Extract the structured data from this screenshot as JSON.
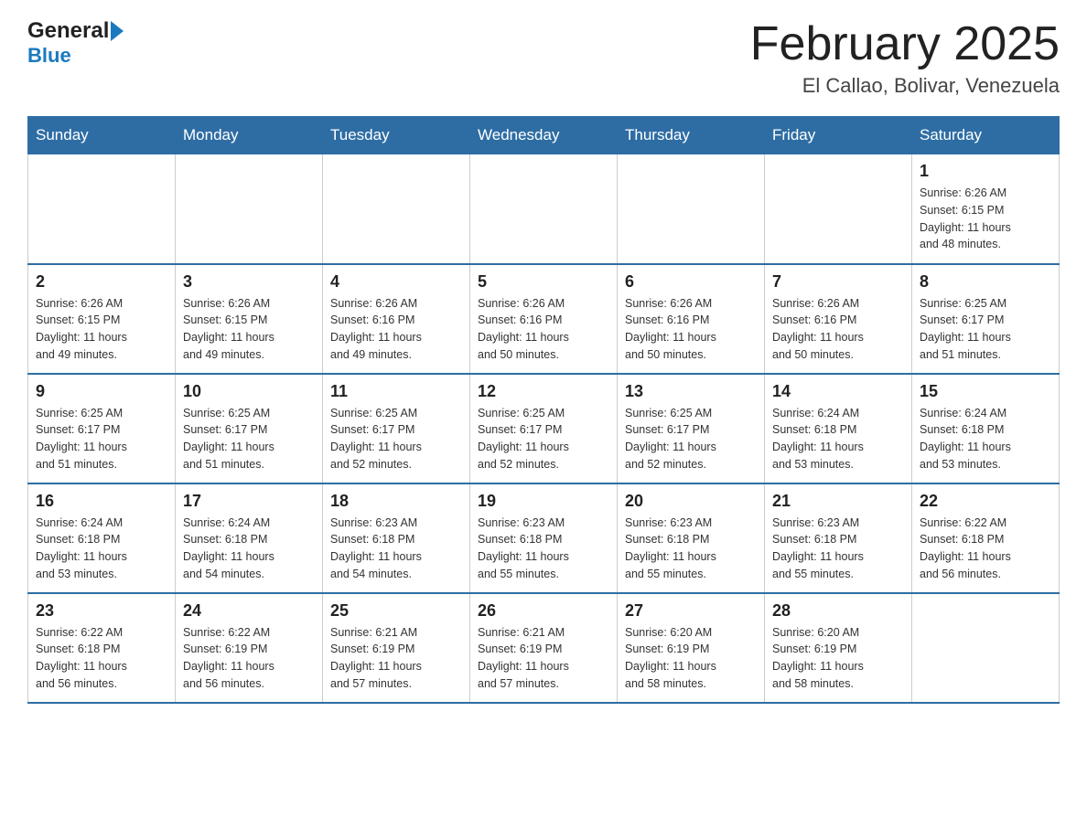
{
  "header": {
    "logo_general": "General",
    "logo_blue": "Blue",
    "title": "February 2025",
    "subtitle": "El Callao, Bolivar, Venezuela"
  },
  "weekdays": [
    "Sunday",
    "Monday",
    "Tuesday",
    "Wednesday",
    "Thursday",
    "Friday",
    "Saturday"
  ],
  "weeks": [
    [
      {
        "day": "",
        "info": ""
      },
      {
        "day": "",
        "info": ""
      },
      {
        "day": "",
        "info": ""
      },
      {
        "day": "",
        "info": ""
      },
      {
        "day": "",
        "info": ""
      },
      {
        "day": "",
        "info": ""
      },
      {
        "day": "1",
        "info": "Sunrise: 6:26 AM\nSunset: 6:15 PM\nDaylight: 11 hours\nand 48 minutes."
      }
    ],
    [
      {
        "day": "2",
        "info": "Sunrise: 6:26 AM\nSunset: 6:15 PM\nDaylight: 11 hours\nand 49 minutes."
      },
      {
        "day": "3",
        "info": "Sunrise: 6:26 AM\nSunset: 6:15 PM\nDaylight: 11 hours\nand 49 minutes."
      },
      {
        "day": "4",
        "info": "Sunrise: 6:26 AM\nSunset: 6:16 PM\nDaylight: 11 hours\nand 49 minutes."
      },
      {
        "day": "5",
        "info": "Sunrise: 6:26 AM\nSunset: 6:16 PM\nDaylight: 11 hours\nand 50 minutes."
      },
      {
        "day": "6",
        "info": "Sunrise: 6:26 AM\nSunset: 6:16 PM\nDaylight: 11 hours\nand 50 minutes."
      },
      {
        "day": "7",
        "info": "Sunrise: 6:26 AM\nSunset: 6:16 PM\nDaylight: 11 hours\nand 50 minutes."
      },
      {
        "day": "8",
        "info": "Sunrise: 6:25 AM\nSunset: 6:17 PM\nDaylight: 11 hours\nand 51 minutes."
      }
    ],
    [
      {
        "day": "9",
        "info": "Sunrise: 6:25 AM\nSunset: 6:17 PM\nDaylight: 11 hours\nand 51 minutes."
      },
      {
        "day": "10",
        "info": "Sunrise: 6:25 AM\nSunset: 6:17 PM\nDaylight: 11 hours\nand 51 minutes."
      },
      {
        "day": "11",
        "info": "Sunrise: 6:25 AM\nSunset: 6:17 PM\nDaylight: 11 hours\nand 52 minutes."
      },
      {
        "day": "12",
        "info": "Sunrise: 6:25 AM\nSunset: 6:17 PM\nDaylight: 11 hours\nand 52 minutes."
      },
      {
        "day": "13",
        "info": "Sunrise: 6:25 AM\nSunset: 6:17 PM\nDaylight: 11 hours\nand 52 minutes."
      },
      {
        "day": "14",
        "info": "Sunrise: 6:24 AM\nSunset: 6:18 PM\nDaylight: 11 hours\nand 53 minutes."
      },
      {
        "day": "15",
        "info": "Sunrise: 6:24 AM\nSunset: 6:18 PM\nDaylight: 11 hours\nand 53 minutes."
      }
    ],
    [
      {
        "day": "16",
        "info": "Sunrise: 6:24 AM\nSunset: 6:18 PM\nDaylight: 11 hours\nand 53 minutes."
      },
      {
        "day": "17",
        "info": "Sunrise: 6:24 AM\nSunset: 6:18 PM\nDaylight: 11 hours\nand 54 minutes."
      },
      {
        "day": "18",
        "info": "Sunrise: 6:23 AM\nSunset: 6:18 PM\nDaylight: 11 hours\nand 54 minutes."
      },
      {
        "day": "19",
        "info": "Sunrise: 6:23 AM\nSunset: 6:18 PM\nDaylight: 11 hours\nand 55 minutes."
      },
      {
        "day": "20",
        "info": "Sunrise: 6:23 AM\nSunset: 6:18 PM\nDaylight: 11 hours\nand 55 minutes."
      },
      {
        "day": "21",
        "info": "Sunrise: 6:23 AM\nSunset: 6:18 PM\nDaylight: 11 hours\nand 55 minutes."
      },
      {
        "day": "22",
        "info": "Sunrise: 6:22 AM\nSunset: 6:18 PM\nDaylight: 11 hours\nand 56 minutes."
      }
    ],
    [
      {
        "day": "23",
        "info": "Sunrise: 6:22 AM\nSunset: 6:18 PM\nDaylight: 11 hours\nand 56 minutes."
      },
      {
        "day": "24",
        "info": "Sunrise: 6:22 AM\nSunset: 6:19 PM\nDaylight: 11 hours\nand 56 minutes."
      },
      {
        "day": "25",
        "info": "Sunrise: 6:21 AM\nSunset: 6:19 PM\nDaylight: 11 hours\nand 57 minutes."
      },
      {
        "day": "26",
        "info": "Sunrise: 6:21 AM\nSunset: 6:19 PM\nDaylight: 11 hours\nand 57 minutes."
      },
      {
        "day": "27",
        "info": "Sunrise: 6:20 AM\nSunset: 6:19 PM\nDaylight: 11 hours\nand 58 minutes."
      },
      {
        "day": "28",
        "info": "Sunrise: 6:20 AM\nSunset: 6:19 PM\nDaylight: 11 hours\nand 58 minutes."
      },
      {
        "day": "",
        "info": ""
      }
    ]
  ]
}
